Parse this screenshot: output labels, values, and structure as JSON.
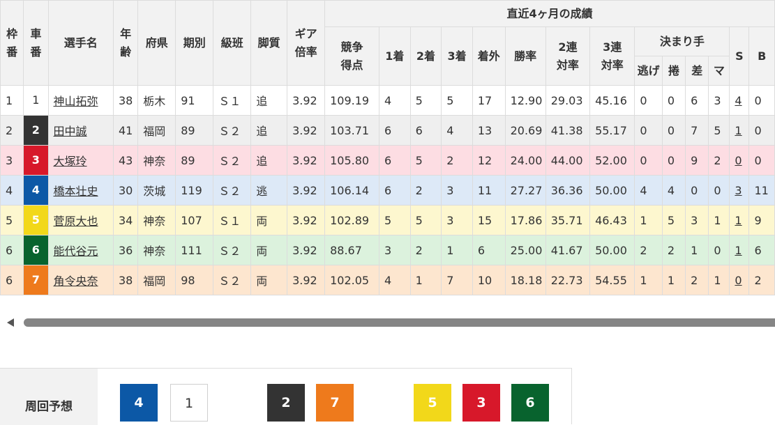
{
  "headers": {
    "waku": "枠\n番",
    "car": "車\n番",
    "name": "選手名",
    "age": "年\n齢",
    "pref": "府県",
    "term": "期別",
    "class": "級班",
    "leg": "脚質",
    "gear": "ギア\n倍率",
    "recent": "直近4ヶ月の成績",
    "score": "競争\n得点",
    "first": "1着",
    "second": "2着",
    "third": "3着",
    "out": "着外",
    "win_rate": "勝率",
    "quinella": "2連\n対率",
    "trio": "3連\n対率",
    "kimarite": "決まり手",
    "nige": "逃げ",
    "makuri": "捲",
    "sashi": "差",
    "mark": "マ",
    "s": "S",
    "b": "B"
  },
  "riders": [
    {
      "waku": "1",
      "car": "1",
      "name": "神山拓弥",
      "age": "38",
      "pref": "栃木",
      "term": "91",
      "class": "Ｓ１",
      "leg": "追",
      "gear": "3.92",
      "score": "109.19",
      "first": "4",
      "second": "5",
      "third": "5",
      "out": "17",
      "win": "12.90",
      "quin": "29.03",
      "trio": "45.16",
      "nige": "0",
      "makuri": "0",
      "sashi": "6",
      "mark": "3",
      "s": "4",
      "b": "0"
    },
    {
      "waku": "2",
      "car": "2",
      "name": "田中誠",
      "age": "41",
      "pref": "福岡",
      "term": "89",
      "class": "Ｓ２",
      "leg": "追",
      "gear": "3.92",
      "score": "103.71",
      "first": "6",
      "second": "6",
      "third": "4",
      "out": "13",
      "win": "20.69",
      "quin": "41.38",
      "trio": "55.17",
      "nige": "0",
      "makuri": "0",
      "sashi": "7",
      "mark": "5",
      "s": "1",
      "b": "0"
    },
    {
      "waku": "3",
      "car": "3",
      "name": "大塚玲",
      "age": "43",
      "pref": "神奈",
      "term": "89",
      "class": "Ｓ２",
      "leg": "追",
      "gear": "3.92",
      "score": "105.80",
      "first": "6",
      "second": "5",
      "third": "2",
      "out": "12",
      "win": "24.00",
      "quin": "44.00",
      "trio": "52.00",
      "nige": "0",
      "makuri": "0",
      "sashi": "9",
      "mark": "2",
      "s": "0",
      "b": "0"
    },
    {
      "waku": "4",
      "car": "4",
      "name": "橋本壮史",
      "age": "30",
      "pref": "茨城",
      "term": "119",
      "class": "Ｓ２",
      "leg": "逃",
      "gear": "3.92",
      "score": "106.14",
      "first": "6",
      "second": "2",
      "third": "3",
      "out": "11",
      "win": "27.27",
      "quin": "36.36",
      "trio": "50.00",
      "nige": "4",
      "makuri": "4",
      "sashi": "0",
      "mark": "0",
      "s": "3",
      "b": "11"
    },
    {
      "waku": "5",
      "car": "5",
      "name": "菅原大也",
      "age": "34",
      "pref": "神奈",
      "term": "107",
      "class": "Ｓ１",
      "leg": "両",
      "gear": "3.92",
      "score": "102.89",
      "first": "5",
      "second": "5",
      "third": "3",
      "out": "15",
      "win": "17.86",
      "quin": "35.71",
      "trio": "46.43",
      "nige": "1",
      "makuri": "5",
      "sashi": "3",
      "mark": "1",
      "s": "1",
      "b": "9"
    },
    {
      "waku": "6",
      "car": "6",
      "name": "能代谷元",
      "age": "36",
      "pref": "神奈",
      "term": "111",
      "class": "Ｓ２",
      "leg": "両",
      "gear": "3.92",
      "score": "88.67",
      "first": "3",
      "second": "2",
      "third": "1",
      "out": "6",
      "win": "25.00",
      "quin": "41.67",
      "trio": "50.00",
      "nige": "2",
      "makuri": "2",
      "sashi": "1",
      "mark": "0",
      "s": "1",
      "b": "6"
    },
    {
      "waku": "6",
      "car": "7",
      "name": "角令央奈",
      "age": "38",
      "pref": "福岡",
      "term": "98",
      "class": "Ｓ２",
      "leg": "両",
      "gear": "3.92",
      "score": "102.05",
      "first": "4",
      "second": "1",
      "third": "7",
      "out": "10",
      "win": "18.18",
      "quin": "22.73",
      "trio": "54.55",
      "nige": "1",
      "makuri": "1",
      "sashi": "2",
      "mark": "1",
      "s": "0",
      "b": "2"
    }
  ],
  "forecast": {
    "label": "周回予想",
    "order": [
      "4",
      "1",
      "2",
      "7",
      "5",
      "3",
      "6"
    ]
  },
  "colors": {
    "car1": "#ffffff",
    "car2": "#333333",
    "car3": "#d7182a",
    "car4": "#0c58a6",
    "car5": "#f2d81a",
    "car6": "#08632e",
    "car7": "#ee7a1c"
  }
}
